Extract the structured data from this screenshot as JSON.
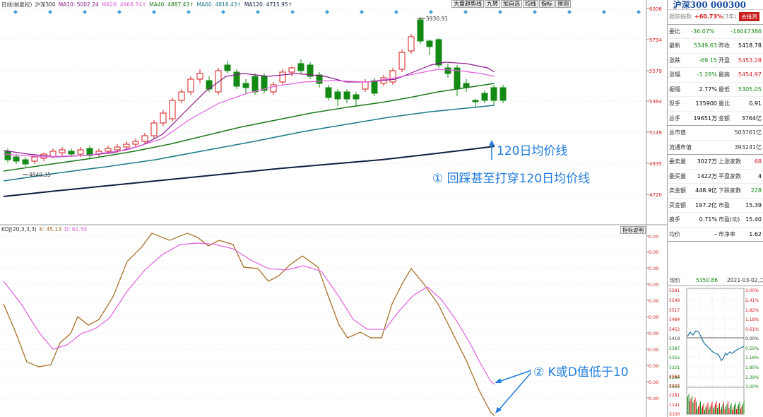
{
  "toolbar": {
    "buttons": [
      "大盘趋势线",
      "九转",
      "加自选",
      "均线",
      "指标",
      "预测"
    ]
  },
  "main_chart": {
    "ma_legend": [
      {
        "label": "日线(前复权)",
        "color": "#333333"
      },
      {
        "label": "沪深300",
        "color": "#333333"
      },
      {
        "label": "MA10: 5002.24",
        "color": "#8b1a8b"
      },
      {
        "label": "MA20: 4968.74↑",
        "color": "#e060e0"
      },
      {
        "label": "MA40: 4887.43↑",
        "color": "#1e7a1e"
      },
      {
        "label": "MA60: 4818.43↑",
        "color": "#1a7a8a"
      },
      {
        "label": "MA120: 4715.95↑",
        "color": "#102040"
      }
    ],
    "price_axis": [
      "6006",
      "5794",
      "5579",
      "5364",
      "5149",
      "4935",
      "4720"
    ],
    "high_label": "5930.91",
    "low_label": "4849.35",
    "colors": {
      "up": "#d61a1a",
      "down": "#138a13",
      "ma10": "#8b1a8b",
      "ma20": "#e060e0",
      "ma40": "#1e7a1e",
      "ma60": "#1a7a8a",
      "ma120": "#102040"
    }
  },
  "kdj": {
    "legend": [
      {
        "label": "KDJ(20,3,3,3)",
        "color": "#333333"
      },
      {
        "label": "K: 45.13",
        "color": "#a0651a"
      },
      {
        "label": "D: 62.54",
        "color": "#e060e0"
      }
    ],
    "button": "指标说明",
    "axis_labels": [
      "0.00",
      "0.00",
      "0.00",
      "0.00",
      "0.00",
      "0.00",
      "0.00",
      "0.00",
      "0.00",
      "0.00",
      "0.00"
    ]
  },
  "annotations": {
    "ma120_label": "120日均价线",
    "note1": "① 回踩甚至打穿120日均价线",
    "note2": "② K或D值低于10"
  },
  "quote": {
    "title": "沪深300 000300",
    "follow_label": "跟踪指数",
    "follow_value": "+60.73%",
    "follow_period": "(3年)",
    "unfollow_button": "去投资",
    "rows_top": [
      {
        "l1": "委比",
        "v1": "-36.07%",
        "c1": "green",
        "l2": "",
        "v2": "-16047386",
        "c2": "green"
      },
      {
        "l1": "最新",
        "v1": "5349.63",
        "c1": "green",
        "l2": "昨收",
        "v2": "5418.78",
        "c2": "blk"
      },
      {
        "l1": "涨跌",
        "v1": "-69.15",
        "c1": "green",
        "l2": "开盘",
        "v2": "5453.28",
        "c2": "red"
      },
      {
        "l1": "涨幅",
        "v1": "-1.28%",
        "c1": "green",
        "l2": "最高",
        "v2": "5454.97",
        "c2": "red"
      },
      {
        "l1": "振幅",
        "v1": "2.77%",
        "c1": "blk",
        "l2": "最低",
        "v2": "5305.05",
        "c2": "green"
      },
      {
        "l1": "现手",
        "v1": "135900",
        "c1": "blk",
        "l2": "量比",
        "v2": "0.91",
        "c2": "blk"
      },
      {
        "l1": "总手",
        "v1": "19651万",
        "c1": "blk",
        "l2": "金额",
        "v2": "3764亿",
        "c2": "blk"
      }
    ],
    "rows_cap": [
      {
        "l": "总市值",
        "v": "503761亿"
      },
      {
        "l": "流通市值",
        "v": "393241亿"
      }
    ],
    "rows_mid": [
      {
        "l1": "委卖量",
        "v1": "3027万",
        "c1": "blk",
        "l2": "上涨家数",
        "v2": "68",
        "c2": "red"
      },
      {
        "l1": "委买量",
        "v1": "1422万",
        "c1": "blk",
        "l2": "平盘家数",
        "v2": "4",
        "c2": "blk"
      },
      {
        "l1": "卖金额",
        "v1": "448.9亿",
        "c1": "blk",
        "l2": "下跌家数",
        "v2": "228",
        "c2": "green"
      },
      {
        "l1": "买金额",
        "v1": "197.2亿",
        "c1": "blk",
        "l2": "市盈",
        "v2": "15.39",
        "c2": "blk"
      },
      {
        "l1": "换手",
        "v1": "0.71%",
        "c1": "blk",
        "l2": "市盈(动)",
        "v2": "15.40",
        "c2": "blk"
      },
      {
        "l1": "均价",
        "v1": "–",
        "c1": "blk",
        "l2": "市净率",
        "v2": "1.62",
        "c2": "blk"
      }
    ],
    "mini": {
      "price_label": "现价",
      "price_value": "5350.86",
      "date": "2021-03-02,二",
      "left_axis": [
        "5581",
        "5549",
        "5517",
        "5484",
        "5452",
        "5419",
        "5387",
        "5355",
        "5321",
        "5289",
        "5256"
      ],
      "right_axis": [
        "3.00%",
        "2.41%",
        "1.82%",
        "1.18%",
        "0.61%",
        "0.00%",
        "0.59%",
        "1.18%",
        "1.80%",
        "2.39%",
        "3.00%"
      ],
      "vol_axis": [
        "4562",
        "3422",
        "2281",
        "1141",
        "X100"
      ]
    }
  }
}
